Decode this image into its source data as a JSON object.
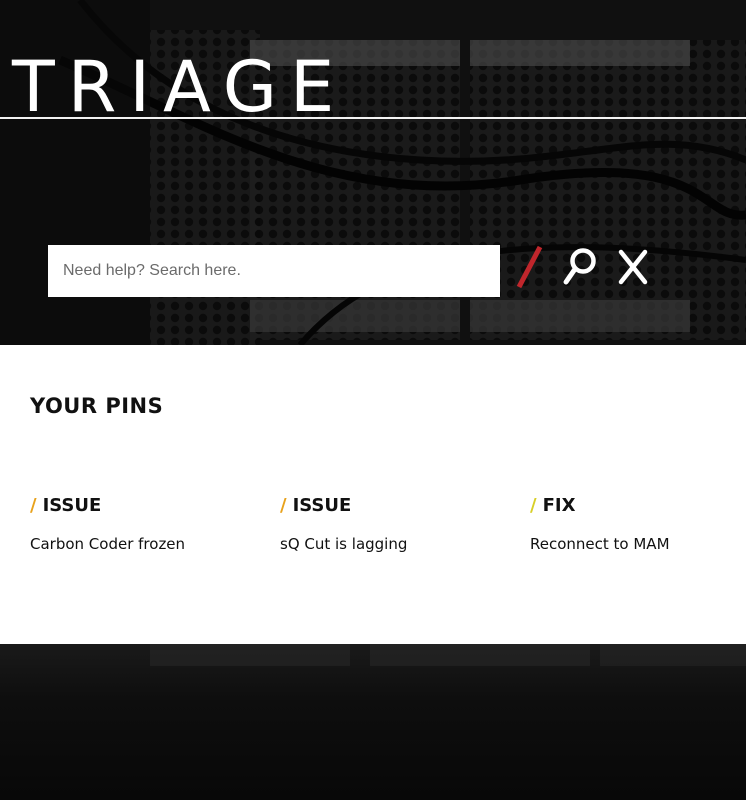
{
  "header": {
    "logo_text": "TRIAGE"
  },
  "search": {
    "placeholder": "Need help? Search here."
  },
  "icons": {
    "slash": "slash-icon",
    "search": "search-icon",
    "close": "close-icon"
  },
  "colors": {
    "slash_red": "#c0262c",
    "issue_orange": "#e8a21c",
    "fix_yellow": "#d8cf28"
  },
  "pins": {
    "title": "YOUR PINS",
    "items": [
      {
        "type": "ISSUE",
        "text": "Carbon Coder frozen",
        "slash": "/"
      },
      {
        "type": "ISSUE",
        "text": "sQ Cut is lagging",
        "slash": "/"
      },
      {
        "type": "FIX",
        "text": "Reconnect to MAM",
        "slash": "/"
      }
    ]
  }
}
